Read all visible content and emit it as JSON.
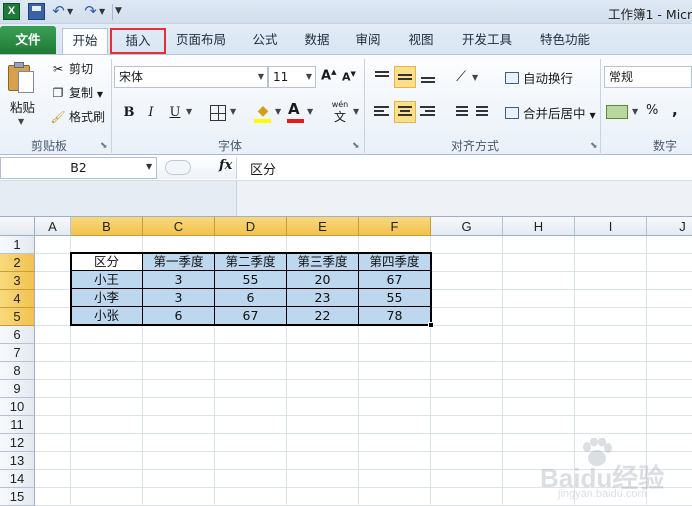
{
  "window": {
    "title": "工作簿1 - Micr",
    "app_icon_letter": "X"
  },
  "tabs": [
    {
      "label": "文件"
    },
    {
      "label": "开始"
    },
    {
      "label": "插入"
    },
    {
      "label": "页面布局"
    },
    {
      "label": "公式"
    },
    {
      "label": "数据"
    },
    {
      "label": "审阅"
    },
    {
      "label": "视图"
    },
    {
      "label": "开发工具"
    },
    {
      "label": "特色功能"
    }
  ],
  "highlighted_tab_border_color": "#e2303a",
  "ribbon": {
    "clipboard": {
      "label": "剪贴板",
      "paste": "粘贴",
      "cut": "剪切",
      "copy": "复制",
      "format_painter": "格式刷"
    },
    "font": {
      "label": "字体",
      "font_name": "宋体",
      "font_size": "11",
      "bold": "B",
      "italic": "I",
      "underline": "U",
      "grow": "A",
      "shrink": "A",
      "font_color_letter": "A",
      "phonetic_top": "wén",
      "phonetic_bottom": "文"
    },
    "alignment": {
      "label": "对齐方式",
      "wrap_text": "自动换行",
      "merge_center": "合并后居中"
    },
    "number": {
      "label": "数字",
      "format": "常规",
      "percent": "%",
      "comma": ","
    }
  },
  "formula_bar": {
    "name_box": "B2",
    "fx": "fx",
    "content": "区分"
  },
  "grid": {
    "columns": [
      "A",
      "B",
      "C",
      "D",
      "E",
      "F",
      "G",
      "H",
      "I",
      "J"
    ],
    "rows": [
      "1",
      "2",
      "3",
      "4",
      "5",
      "6",
      "7",
      "8",
      "9",
      "10",
      "11",
      "12",
      "13",
      "14",
      "15"
    ],
    "selected_columns": [
      "B",
      "C",
      "D",
      "E",
      "F"
    ],
    "selected_rows": [
      "2",
      "3",
      "4",
      "5"
    ],
    "selection_fill": "#bdd7ee"
  },
  "table": {
    "headers": [
      "区分",
      "第一季度",
      "第二季度",
      "第三季度",
      "第四季度"
    ],
    "rows": [
      [
        "小王",
        "3",
        "55",
        "20",
        "67"
      ],
      [
        "小李",
        "3",
        "6",
        "23",
        "55"
      ],
      [
        "小张",
        "6",
        "67",
        "22",
        "78"
      ]
    ]
  },
  "watermark": {
    "text": "Baidu经验",
    "sub": "jingyan.baidu.com"
  }
}
